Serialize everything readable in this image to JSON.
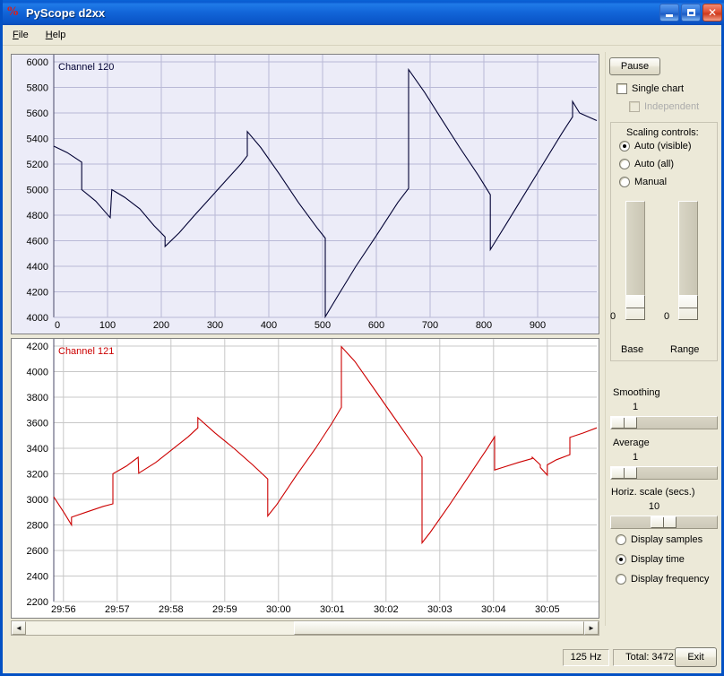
{
  "window": {
    "title": "PyScope d2xx",
    "icon": "pyscope-icon",
    "min_label": "Minimize",
    "max_label": "Maximize",
    "close_label": "Close"
  },
  "menu": {
    "items": [
      {
        "label": "File",
        "mnemonic": "F"
      },
      {
        "label": "Help",
        "mnemonic": "H"
      }
    ]
  },
  "colors": {
    "titlebar": "#0a5ad0",
    "window_face": "#ece9d8",
    "chart_top_bg": "#ececf8",
    "chart_bottom_bg": "#ffffff",
    "trace_top": "#000033",
    "trace_bottom": "#cc0000",
    "grid": "#b9b9d6",
    "grid_bottom": "#c8c8c8"
  },
  "controls": {
    "pause_label": "Pause",
    "single_chart": {
      "label": "Single chart",
      "checked": false
    },
    "independent": {
      "label": "Independent",
      "checked": false,
      "disabled": true
    },
    "scaling_title": "Scaling controls:",
    "scaling_options": [
      {
        "label": "Auto (visible)",
        "selected": true
      },
      {
        "label": "Auto (all)",
        "selected": false
      },
      {
        "label": "Manual",
        "selected": false
      }
    ],
    "base_slider": {
      "label": "Base",
      "value": "0"
    },
    "range_slider": {
      "label": "Range",
      "value": "0"
    },
    "smoothing": {
      "label": "Smoothing",
      "value": "1"
    },
    "average": {
      "label": "Average",
      "value": "1"
    },
    "horiz_scale": {
      "label": "Horiz. scale (secs.)",
      "value": "10"
    },
    "display_options": [
      {
        "label": "Display samples",
        "selected": false
      },
      {
        "label": "Display time",
        "selected": true
      },
      {
        "label": "Display frequency",
        "selected": false
      }
    ]
  },
  "scrollbar": {
    "left_arrow": "◄",
    "right_arrow": "►"
  },
  "statusbar": {
    "rate": "125 Hz",
    "total": "Total: 3472",
    "exit_label": "Exit"
  },
  "chart_data": [
    {
      "type": "line",
      "id": "chart-top",
      "title": "Channel 120",
      "xlabel": "",
      "ylabel": "",
      "xlim": [
        0,
        1010
      ],
      "ylim": [
        4000,
        6000
      ],
      "xticks": [
        0,
        100,
        200,
        300,
        400,
        500,
        600,
        700,
        800,
        900
      ],
      "xticklabels": [
        "0",
        "100",
        "200",
        "300",
        "400",
        "500",
        "600",
        "700",
        "800",
        "900"
      ],
      "yticks": [
        4000,
        4200,
        4400,
        4600,
        4800,
        5000,
        5200,
        5400,
        5600,
        5800,
        6000
      ],
      "yticklabels": [
        "4000",
        "4200",
        "4400",
        "4600",
        "4800",
        "5000",
        "5200",
        "5400",
        "5600",
        "5800",
        "6000"
      ],
      "grid": true,
      "legend": "Channel 120",
      "color": "#000033",
      "points": [
        [
          0,
          5340
        ],
        [
          25,
          5290
        ],
        [
          52,
          5215
        ],
        [
          52,
          5000
        ],
        [
          78,
          4910
        ],
        [
          105,
          4780
        ],
        [
          108,
          5000
        ],
        [
          132,
          4940
        ],
        [
          160,
          4850
        ],
        [
          186,
          4720
        ],
        [
          207,
          4630
        ],
        [
          207,
          4555
        ],
        [
          233,
          4660
        ],
        [
          262,
          4800
        ],
        [
          290,
          4930
        ],
        [
          320,
          5070
        ],
        [
          348,
          5200
        ],
        [
          360,
          5265
        ],
        [
          360,
          5455
        ],
        [
          385,
          5330
        ],
        [
          420,
          5120
        ],
        [
          455,
          4900
        ],
        [
          490,
          4700
        ],
        [
          505,
          4620
        ],
        [
          505,
          4005
        ],
        [
          530,
          4180
        ],
        [
          562,
          4400
        ],
        [
          600,
          4640
        ],
        [
          640,
          4900
        ],
        [
          660,
          5010
        ],
        [
          660,
          5940
        ],
        [
          690,
          5760
        ],
        [
          720,
          5560
        ],
        [
          755,
          5330
        ],
        [
          790,
          5110
        ],
        [
          812,
          4960
        ],
        [
          812,
          4530
        ],
        [
          840,
          4720
        ],
        [
          875,
          4960
        ],
        [
          910,
          5200
        ],
        [
          945,
          5440
        ],
        [
          965,
          5570
        ],
        [
          965,
          5690
        ],
        [
          978,
          5600
        ],
        [
          1010,
          5540
        ]
      ]
    },
    {
      "type": "line",
      "id": "chart-bottom",
      "title": "Channel 121",
      "xlabel": "",
      "ylabel": "",
      "xlim": [
        0,
        1010
      ],
      "ylim": [
        2200,
        4200
      ],
      "xticks": [
        18,
        118,
        218,
        318,
        418,
        518,
        618,
        718,
        818,
        918
      ],
      "xticklabels": [
        "29:56",
        "29:57",
        "29:58",
        "29:59",
        "30:00",
        "30:01",
        "30:02",
        "30:03",
        "30:04",
        "30:05"
      ],
      "yticks": [
        2200,
        2400,
        2600,
        2800,
        3000,
        3200,
        3400,
        3600,
        3800,
        4000,
        4200
      ],
      "yticklabels": [
        "2200",
        "2400",
        "2600",
        "2800",
        "3000",
        "3200",
        "3400",
        "3600",
        "3800",
        "4000",
        "4200"
      ],
      "grid": true,
      "legend": "Channel 121",
      "color": "#cc0000",
      "points": [
        [
          0,
          3020
        ],
        [
          20,
          2890
        ],
        [
          33,
          2800
        ],
        [
          33,
          2860
        ],
        [
          60,
          2900
        ],
        [
          92,
          2945
        ],
        [
          110,
          2965
        ],
        [
          110,
          3200
        ],
        [
          135,
          3260
        ],
        [
          157,
          3330
        ],
        [
          158,
          3205
        ],
        [
          190,
          3290
        ],
        [
          220,
          3390
        ],
        [
          250,
          3490
        ],
        [
          268,
          3560
        ],
        [
          268,
          3640
        ],
        [
          300,
          3520
        ],
        [
          335,
          3400
        ],
        [
          370,
          3270
        ],
        [
          398,
          3160
        ],
        [
          398,
          2870
        ],
        [
          415,
          2960
        ],
        [
          450,
          3180
        ],
        [
          487,
          3400
        ],
        [
          518,
          3600
        ],
        [
          535,
          3720
        ],
        [
          535,
          4195
        ],
        [
          560,
          4080
        ],
        [
          595,
          3870
        ],
        [
          630,
          3660
        ],
        [
          665,
          3450
        ],
        [
          685,
          3330
        ],
        [
          685,
          2660
        ],
        [
          700,
          2740
        ],
        [
          735,
          2950
        ],
        [
          770,
          3170
        ],
        [
          805,
          3390
        ],
        [
          820,
          3490
        ],
        [
          820,
          3230
        ],
        [
          835,
          3250
        ],
        [
          865,
          3290
        ],
        [
          890,
          3320
        ],
        [
          890,
          3330
        ],
        [
          905,
          3270
        ],
        [
          905,
          3250
        ],
        [
          918,
          3190
        ],
        [
          918,
          3270
        ],
        [
          935,
          3310
        ],
        [
          960,
          3350
        ],
        [
          960,
          3485
        ],
        [
          985,
          3520
        ],
        [
          1010,
          3560
        ]
      ]
    }
  ]
}
